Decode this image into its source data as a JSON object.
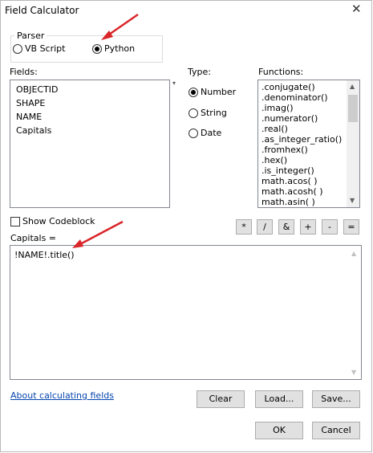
{
  "window": {
    "title": "Field Calculator",
    "close_symbol": "✕"
  },
  "parser": {
    "label": "Parser",
    "options": [
      "VB Script",
      "Python"
    ],
    "selected": "Python"
  },
  "fields": {
    "label": "Fields:",
    "items": [
      "OBJECTID",
      "SHAPE",
      "NAME",
      "Capitals"
    ]
  },
  "type": {
    "label": "Type:",
    "options": [
      "Number",
      "String",
      "Date"
    ],
    "selected": "Number"
  },
  "functions": {
    "label": "Functions:",
    "items": [
      ".conjugate()",
      ".denominator()",
      ".imag()",
      ".numerator()",
      ".real()",
      ".as_integer_ratio()",
      ".fromhex()",
      ".hex()",
      ".is_integer()",
      "math.acos( )",
      "math.acosh( )",
      "math.asin( )"
    ]
  },
  "codeblock": {
    "label": "Show Codeblock",
    "checked": false
  },
  "operators": [
    "*",
    "/",
    "&",
    "+",
    "-",
    "="
  ],
  "expression": {
    "label": "Capitals =",
    "value": "!NAME!.title()"
  },
  "help_link": "About calculating fields",
  "buttons": {
    "clear": "Clear",
    "load": "Load...",
    "save": "Save...",
    "ok": "OK",
    "cancel": "Cancel"
  },
  "annotations": {
    "arrow_color": "#d9262a"
  }
}
